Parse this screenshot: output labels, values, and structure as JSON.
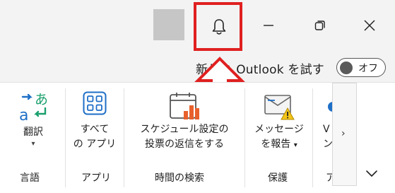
{
  "titlebar": {
    "notifications_icon": "bell-icon",
    "minimize_icon": "minimize-icon",
    "restore_icon": "restore-icon",
    "close_icon": "close-icon",
    "highlight_color": "#e02020"
  },
  "try_new": {
    "label": "新しい Outlook を試す",
    "toggle_text": "オフ",
    "toggle_state": "off"
  },
  "ribbon": {
    "groups": [
      {
        "label": "言語",
        "commands": [
          {
            "label_line1": "翻訳",
            "icon": "translate-icon",
            "has_dropdown": true
          }
        ]
      },
      {
        "label": "アプリ",
        "commands": [
          {
            "label_line1": "すべて",
            "label_line2": "の アプリ",
            "icon": "all-apps-icon"
          }
        ]
      },
      {
        "label": "時間の検索",
        "commands": [
          {
            "label_line1": "スケジュール設定の",
            "label_line2": "投票の返信をする",
            "icon": "scheduling-poll-icon"
          }
        ]
      },
      {
        "label": "保護",
        "commands": [
          {
            "label_line1": "メッセージ",
            "label_line2": "を報告",
            "icon": "report-message-icon",
            "has_dropdown": true
          }
        ]
      },
      {
        "label": "ア",
        "commands": [
          {
            "label_line1": "V",
            "label_line2": "ン",
            "icon": "partial-addin-icon"
          }
        ]
      }
    ],
    "more_label": "›",
    "collapse_icon": "chevron-down-icon"
  }
}
